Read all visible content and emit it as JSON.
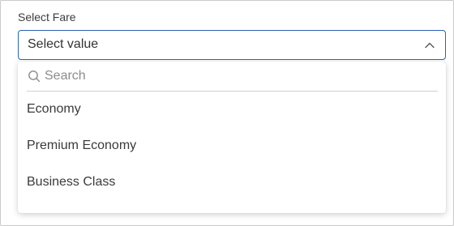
{
  "field": {
    "label": "Select Fare",
    "selected_value": "Select value",
    "chevron_icon": "chevron-up-icon"
  },
  "dropdown": {
    "search_placeholder": "Search",
    "search_value": "",
    "search_icon": "search-icon",
    "options": [
      {
        "label": "Economy"
      },
      {
        "label": "Premium Economy"
      },
      {
        "label": "Business Class"
      }
    ]
  },
  "colors": {
    "focus_border": "#2b63b8",
    "divider": "#cfcfcf",
    "text": "#3a3a3a",
    "placeholder": "#8c8c8c"
  }
}
